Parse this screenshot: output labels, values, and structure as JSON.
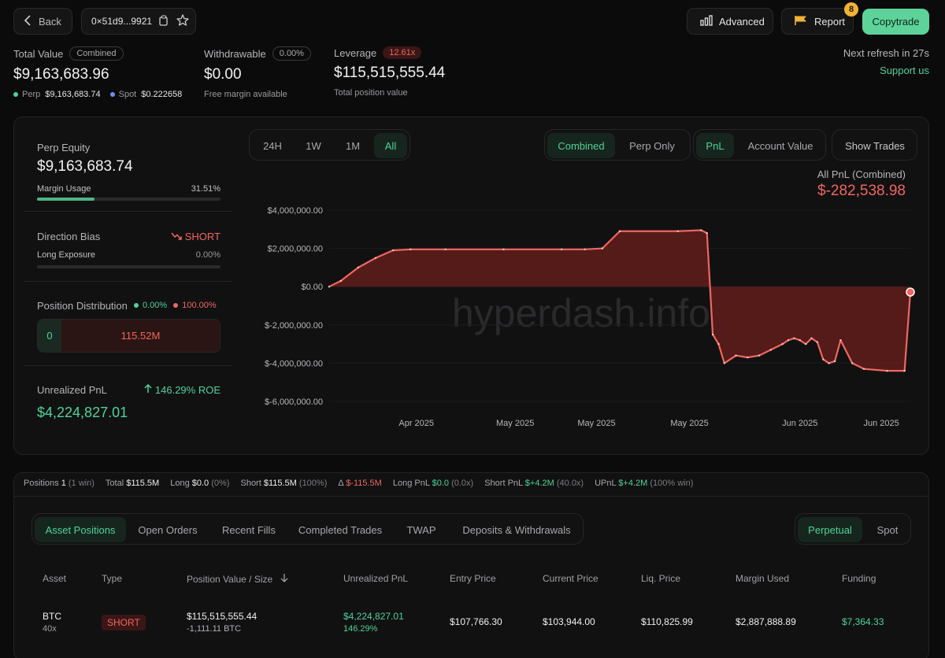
{
  "header": {
    "back_label": "Back",
    "address": "0×51d9...9921",
    "advanced_label": "Advanced",
    "report_label": "Report",
    "report_badge": "8",
    "copytrade_label": "Copytrade",
    "refresh_text": "Next refresh in 27s",
    "support_label": "Support us"
  },
  "summary": {
    "total_value_label": "Total Value",
    "total_value_badge": "Combined",
    "total_value": "$9,163,683.96",
    "perp_label": "Perp",
    "perp_value": "$9,163,683.74",
    "spot_label": "Spot",
    "spot_value": "$0.222658",
    "withdrawable_label": "Withdrawable",
    "withdrawable_badge": "0.00%",
    "withdrawable_value": "$0.00",
    "withdrawable_sub": "Free margin available",
    "leverage_label": "Leverage",
    "leverage_badge": "12.61x",
    "leverage_value": "$115,515,555.44",
    "leverage_sub": "Total position value"
  },
  "left_panel": {
    "perp_equity_label": "Perp Equity",
    "perp_equity_value": "$9,163,683.74",
    "margin_usage_label": "Margin Usage",
    "margin_usage_value": "31.51%",
    "margin_usage_fraction": 0.3151,
    "direction_bias_label": "Direction Bias",
    "direction_bias_value": "SHORT",
    "long_exposure_label": "Long Exposure",
    "long_exposure_value": "0.00%",
    "position_dist_label": "Position Distribution",
    "dist_long_pct": "0.00%",
    "dist_short_pct": "100.00%",
    "dist_long_value": "0",
    "dist_short_value": "115.52M",
    "unrealized_label": "Unrealized PnL",
    "roe_text": "146.29% ROE",
    "unrealized_value": "$4,224,827.01"
  },
  "chart_controls": {
    "ranges": [
      "24H",
      "1W",
      "1M",
      "All"
    ],
    "active_range": "All",
    "modes": [
      "Combined",
      "Perp Only"
    ],
    "active_mode": "Combined",
    "metrics": [
      "PnL",
      "Account Value"
    ],
    "active_metric": "PnL",
    "show_trades_label": "Show Trades",
    "pnl_title": "All PnL (Combined)",
    "pnl_value": "$-282,538.98",
    "watermark": "hyperdash.info"
  },
  "chart_data": {
    "type": "area",
    "y_ticks": [
      "$4,000,000.00",
      "$2,000,000.00",
      "$0.00",
      "$-2,000,000.00",
      "$-4,000,000.00",
      "$-6,000,000.00"
    ],
    "ylim": [
      -6000000,
      4000000
    ],
    "x_ticks": [
      "Apr 2025",
      "May 2025",
      "May 2025",
      "May 2025",
      "Jun 2025",
      "Jun 2025"
    ],
    "x_tick_positions": [
      0.15,
      0.32,
      0.46,
      0.62,
      0.81,
      0.95
    ],
    "series": [
      {
        "x": [
          0.0,
          0.02,
          0.05,
          0.08,
          0.11,
          0.14,
          0.2,
          0.3,
          0.4,
          0.44,
          0.47,
          0.5,
          0.6,
          0.64,
          0.65,
          0.66,
          0.67,
          0.68,
          0.7,
          0.72,
          0.74,
          0.76,
          0.78,
          0.79,
          0.8,
          0.81,
          0.82,
          0.83,
          0.84,
          0.85,
          0.86,
          0.87,
          0.88,
          0.9,
          0.92,
          0.96,
          0.99,
          1.0
        ],
        "y": [
          0,
          300000,
          1000000,
          1500000,
          1900000,
          1950000,
          1950000,
          1950000,
          1950000,
          1950000,
          2000000,
          2900000,
          2900000,
          2950000,
          2800000,
          -2500000,
          -3000000,
          -4000000,
          -3600000,
          -3700000,
          -3600000,
          -3300000,
          -3000000,
          -2800000,
          -2700000,
          -2800000,
          -3000000,
          -2700000,
          -2900000,
          -3800000,
          -4000000,
          -3900000,
          -2800000,
          -4000000,
          -4300000,
          -4400000,
          -4400000,
          -282538.98
        ]
      }
    ],
    "colors": {
      "line": "#f0675f",
      "fill": "#6b1f1c"
    }
  },
  "stats": {
    "positions_label": "Positions",
    "positions_value": "1",
    "positions_sub": "(1 win)",
    "total_label": "Total",
    "total_value": "$115.5M",
    "long_label": "Long",
    "long_value": "$0.0",
    "long_sub": "(0%)",
    "short_label": "Short",
    "short_value": "$115.5M",
    "short_sub": "(100%)",
    "delta_label": "Δ",
    "delta_value": "$-115.5M",
    "long_pnl_label": "Long PnL",
    "long_pnl_value": "$0.0",
    "long_pnl_sub": "(0.0x)",
    "short_pnl_label": "Short PnL",
    "short_pnl_value": "$+4.2M",
    "short_pnl_sub": "(40.0x)",
    "upnl_label": "UPnL",
    "upnl_value": "$+4.2M",
    "upnl_sub": "(100% win)"
  },
  "tabs": {
    "items": [
      "Asset Positions",
      "Open Orders",
      "Recent Fills",
      "Completed Trades",
      "TWAP",
      "Deposits & Withdrawals"
    ],
    "active": "Asset Positions",
    "market_items": [
      "Perpetual",
      "Spot"
    ],
    "active_market": "Perpetual"
  },
  "table": {
    "headers": [
      "Asset",
      "Type",
      "Position Value / Size",
      "Unrealized PnL",
      "Entry Price",
      "Current Price",
      "Liq. Price",
      "Margin Used",
      "Funding"
    ],
    "rows": [
      {
        "asset": "BTC",
        "leverage": "40x",
        "type": "SHORT",
        "position_value": "$115,515,555.44",
        "size": "-1,111.11 BTC",
        "upnl": "$4,224,827.01",
        "upnl_pct": "146.29%",
        "entry": "$107,766.30",
        "current": "$103,944.00",
        "liq": "$110,825.99",
        "margin": "$2,887,888.89",
        "funding": "$7,364.33"
      }
    ]
  }
}
